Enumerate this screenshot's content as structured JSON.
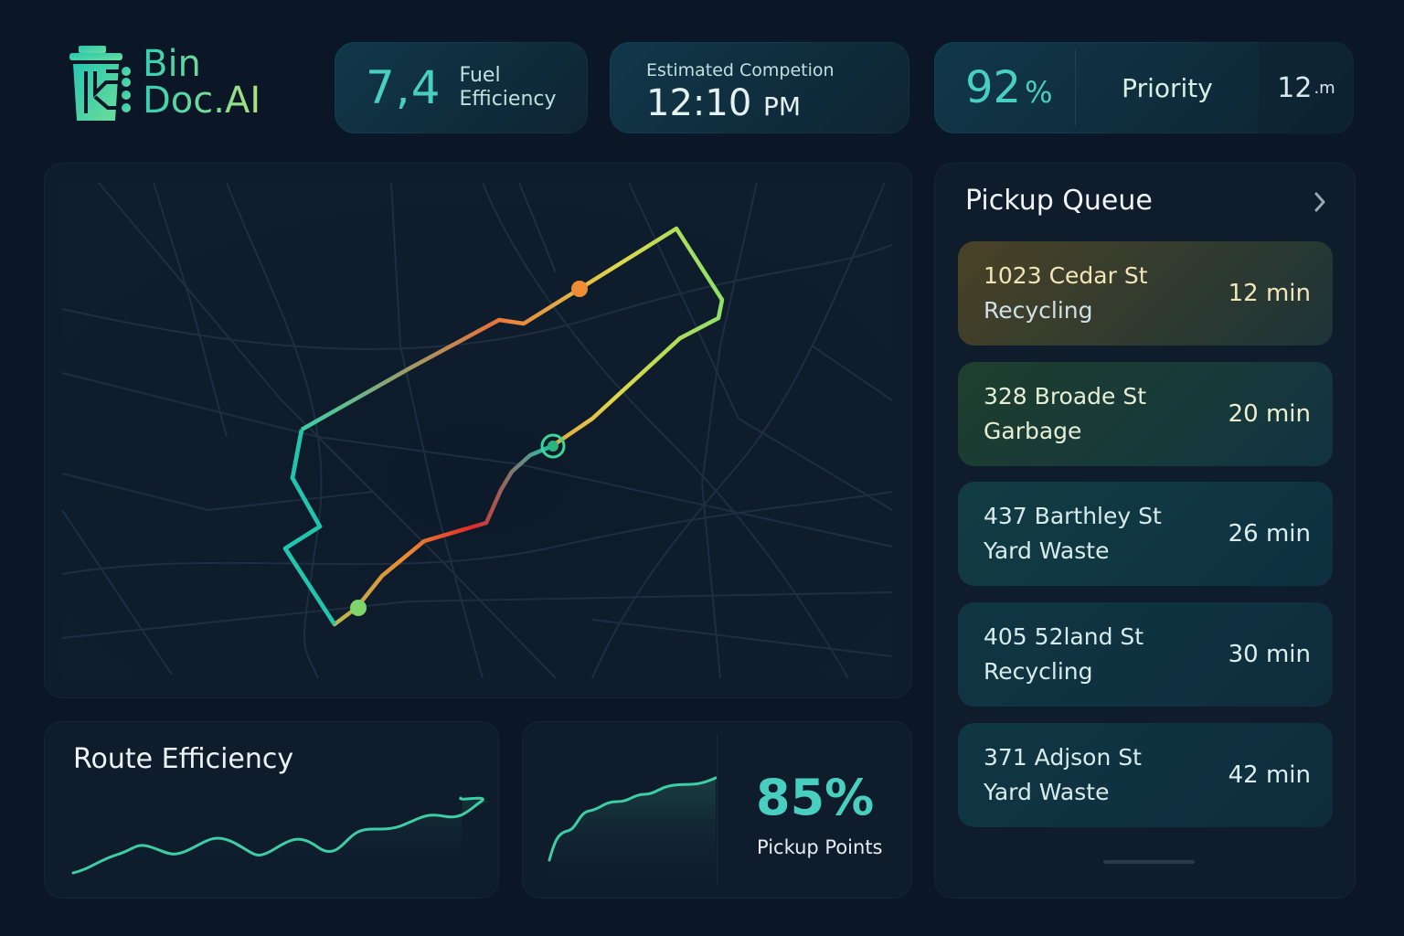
{
  "brand": {
    "line1": "Bin",
    "line2": "Doc.AI"
  },
  "stats": {
    "fuel": {
      "value": "7,4",
      "label_line1": "Fuel",
      "label_line2": "Efficiency"
    },
    "eta": {
      "label": "Estimated Competion",
      "time": "12:10",
      "ampm": "PM"
    },
    "priority": {
      "percent": "92",
      "percent_sign": "%",
      "label": "Priority",
      "right_value": "12",
      "right_unit": ".m"
    }
  },
  "route_efficiency": {
    "title": "Route Efficiency"
  },
  "pickup_points": {
    "value": "85%",
    "label": "Pickup Points"
  },
  "queue": {
    "title": "Pickup Queue",
    "items": [
      {
        "address": "1023 Cedar St",
        "type": "Recycling",
        "eta": "12 min",
        "color": "#3e3a28"
      },
      {
        "address": "328 Broade St",
        "type": "Garbage",
        "eta": "20 min",
        "color": "#1d3a33"
      },
      {
        "address": "437 Barthley St",
        "type": "Yard Waste",
        "eta": "26 min",
        "color": "#113944"
      },
      {
        "address": "405 52land St",
        "type": "Recycling",
        "eta": "30 min",
        "color": "#0f3444"
      },
      {
        "address": "371 Adjson St",
        "type": "Yard Waste",
        "eta": "42 min",
        "color": "#0f3444"
      }
    ]
  },
  "colors": {
    "accent": "#48cfc0",
    "background": "#0b1626",
    "panel": "#0e1c2c"
  }
}
